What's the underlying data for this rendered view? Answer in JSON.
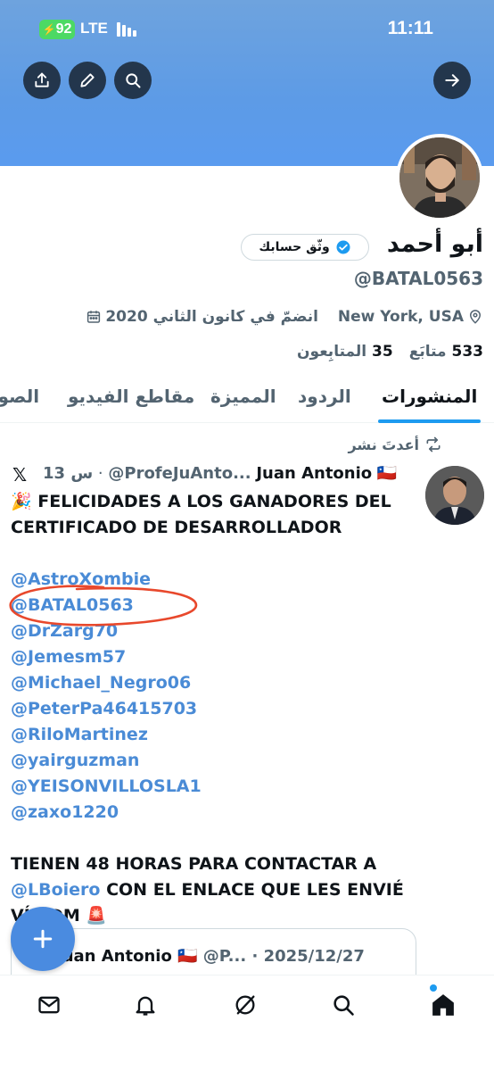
{
  "status_bar": {
    "battery": "92",
    "network": "LTE",
    "time": "11:11"
  },
  "profile": {
    "name": "أبو أحمد",
    "verify_label": "وثّق حسابك",
    "handle": "@BATAL0563",
    "location": "New York, USA",
    "joined": "انضمّ في كانون الثاني 2020",
    "following_count": "533",
    "following_label": "متابَع",
    "followers_count": "35",
    "followers_label": "المتابِعون"
  },
  "tabs": [
    "المنشورات",
    "الردود",
    "المميزة",
    "مقاطع الفيديو",
    "الصور"
  ],
  "post": {
    "repost_label": "أعدتَ نشر",
    "author_name": "Juan Antonio",
    "author_flag": "🇨🇱",
    "author_handle": "@ProfeJuAnto...",
    "time": "13 س",
    "headline": "🎉 FELICIDADES A LOS GANADORES DEL CERTIFICADO DE DESARROLLADOR",
    "mentions": [
      "@AstroXombie",
      "@BATAL0563",
      "@DrZarg70",
      "@Jemesm57",
      "@Michael_Negro06",
      "@PeterPa46415703",
      "@RiloMartinez",
      "@yairguzman",
      "@YEISONVILLOSLA1",
      "@zaxo1220"
    ],
    "footer_before": "TIENEN 48 HORAS PARA CONTACTAR A",
    "footer_mention": "@LBoiero",
    "footer_after": " CON EL ENLACE QUE LES ENVIÉ VÍA DM 🚨"
  },
  "quote": {
    "name": "Juan Antonio",
    "flag": "🇨🇱",
    "handle": "@P...",
    "date": "· 2025/12/27"
  },
  "colors": {
    "accent": "#1d9bf0",
    "banner": "#5d9be6",
    "link": "#4a8bd6",
    "annotation": "#e8482c"
  }
}
